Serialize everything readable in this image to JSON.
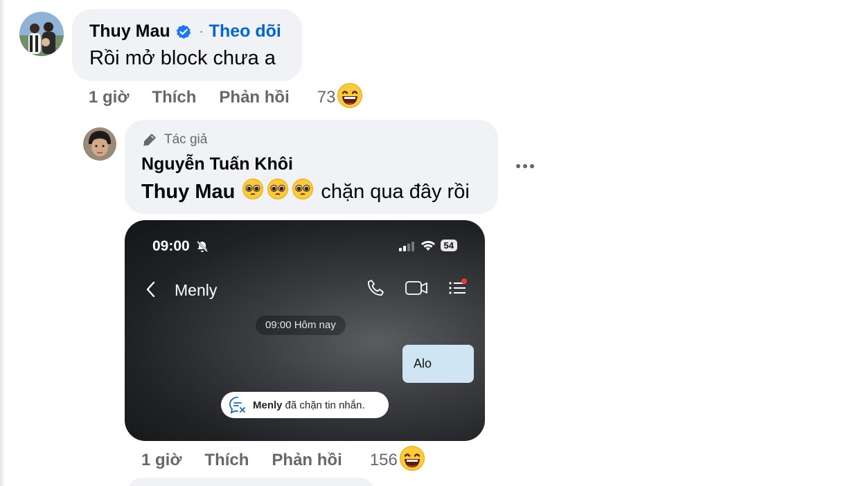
{
  "comment1": {
    "author": "Thuy Mau",
    "follow_label": "Theo dõi",
    "separator": "·",
    "text": "Rồi mở block chưa a",
    "time": "1 giờ",
    "like_label": "Thích",
    "reply_label": "Phản hồi",
    "reaction_count": "73"
  },
  "comment2": {
    "author_tag": "Tác giả",
    "author": "Nguyễn Tuấn Khôi",
    "mention": "Thuy Mau",
    "text": "chặn qua đây rồi",
    "time": "1 giờ",
    "like_label": "Thích",
    "reply_label": "Phản hồi",
    "reaction_count": "156"
  },
  "screenshot": {
    "status_time": "09:00",
    "battery": "54",
    "contact_name": "Menly",
    "date_label": "09:00 Hôm nay",
    "message": "Alo",
    "blocked_name": "Menly",
    "blocked_text": "đã chặn tin nhắn."
  },
  "colors": {
    "bubble_bg": "#f0f2f5",
    "link_blue": "#0064d1",
    "meta_gray": "#65676b"
  }
}
